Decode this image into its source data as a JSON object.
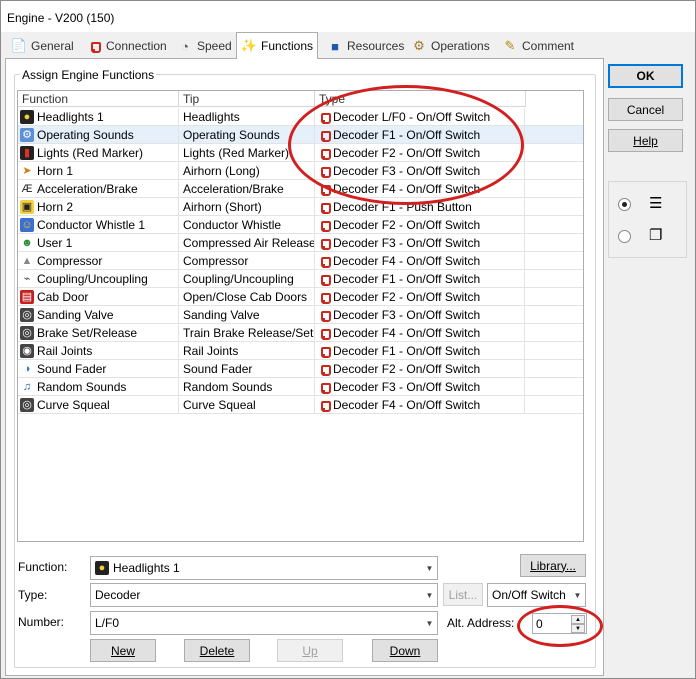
{
  "window": {
    "title": "Engine - V200 (150)"
  },
  "tabs": [
    {
      "label": "General",
      "icon": "general-icon"
    },
    {
      "label": "Connection",
      "icon": "connection-icon"
    },
    {
      "label": "Speed",
      "icon": "speed-icon"
    },
    {
      "label": "Functions",
      "icon": "functions-icon",
      "active": true
    },
    {
      "label": "Resources",
      "icon": "resources-icon"
    },
    {
      "label": "Operations",
      "icon": "operations-icon"
    },
    {
      "label": "Comment",
      "icon": "comment-icon"
    }
  ],
  "group": {
    "title": "Assign Engine Functions"
  },
  "grid": {
    "columns": [
      "Function",
      "Tip",
      "Type"
    ],
    "rows": [
      {
        "function": "Headlights 1",
        "tip": "Headlights",
        "type": "Decoder L/F0 - On/Off Switch",
        "icon": "headlights-icon",
        "selected": false
      },
      {
        "function": "Operating Sounds",
        "tip": "Operating Sounds",
        "type": "Decoder F1 - On/Off Switch",
        "icon": "gear-sound-icon",
        "selected": true
      },
      {
        "function": "Lights (Red Marker)",
        "tip": "Lights (Red Marker)",
        "type": "Decoder F2 - On/Off Switch",
        "icon": "red-marker-icon"
      },
      {
        "function": "Horn 1",
        "tip": "Airhorn (Long)",
        "type": "Decoder F3 - On/Off Switch",
        "icon": "horn-icon"
      },
      {
        "function": "Acceleration/Brake",
        "tip": "Acceleration/Brake",
        "type": "Decoder F4 - On/Off Switch",
        "icon": "abv-icon"
      },
      {
        "function": "Horn 2",
        "tip": "Airhorn (Short)",
        "type": "Decoder F1 - Push Button",
        "icon": "horn-2-icon"
      },
      {
        "function": "Conductor Whistle 1",
        "tip": "Conductor Whistle",
        "type": "Decoder F2 - On/Off Switch",
        "icon": "conductor-icon"
      },
      {
        "function": "User 1",
        "tip": "Compressed Air Release",
        "type": "Decoder F3 - On/Off Switch",
        "icon": "user-icon"
      },
      {
        "function": "Compressor",
        "tip": "Compressor",
        "type": "Decoder F4 - On/Off Switch",
        "icon": "compressor-icon"
      },
      {
        "function": "Coupling/Uncoupling",
        "tip": "Coupling/Uncoupling",
        "type": "Decoder F1 - On/Off Switch",
        "icon": "coupling-icon"
      },
      {
        "function": "Cab Door",
        "tip": "Open/Close Cab Doors",
        "type": "Decoder F2 - On/Off Switch",
        "icon": "cab-door-icon"
      },
      {
        "function": "Sanding Valve",
        "tip": "Sanding Valve",
        "type": "Decoder F3 - On/Off Switch",
        "icon": "sanding-icon"
      },
      {
        "function": "Brake Set/Release",
        "tip": "Train Brake Release/Set",
        "type": "Decoder F4 - On/Off Switch",
        "icon": "brake-icon"
      },
      {
        "function": "Rail Joints",
        "tip": "Rail Joints",
        "type": "Decoder F1 - On/Off Switch",
        "icon": "rail-joints-icon"
      },
      {
        "function": "Sound Fader",
        "tip": "Sound Fader",
        "type": "Decoder F2 - On/Off Switch",
        "icon": "sound-fader-icon"
      },
      {
        "function": "Random Sounds",
        "tip": "Random Sounds",
        "type": "Decoder F3 - On/Off Switch",
        "icon": "music-note-icon"
      },
      {
        "function": "Curve Squeal",
        "tip": "Curve Squeal",
        "type": "Decoder F4 - On/Off Switch",
        "icon": "curve-squeal-icon"
      }
    ]
  },
  "form": {
    "function_label": "Function:",
    "function_value": "Headlights 1",
    "type_label": "Type:",
    "type_value": "Decoder",
    "list_button": "List...",
    "mode_value": "On/Off Switch",
    "number_label": "Number:",
    "number_value": "L/F0",
    "alt_address_label": "Alt. Address:",
    "alt_address_value": "0",
    "library_button": "Library..."
  },
  "actions": {
    "new": "New",
    "delete": "Delete",
    "up": "Up",
    "down": "Down"
  },
  "dialog_buttons": {
    "ok": "OK",
    "cancel": "Cancel",
    "help": "Help"
  },
  "colors": {
    "annotation": "#d1201f",
    "selection": "#e5f0fb",
    "accent": "#0078d7"
  }
}
